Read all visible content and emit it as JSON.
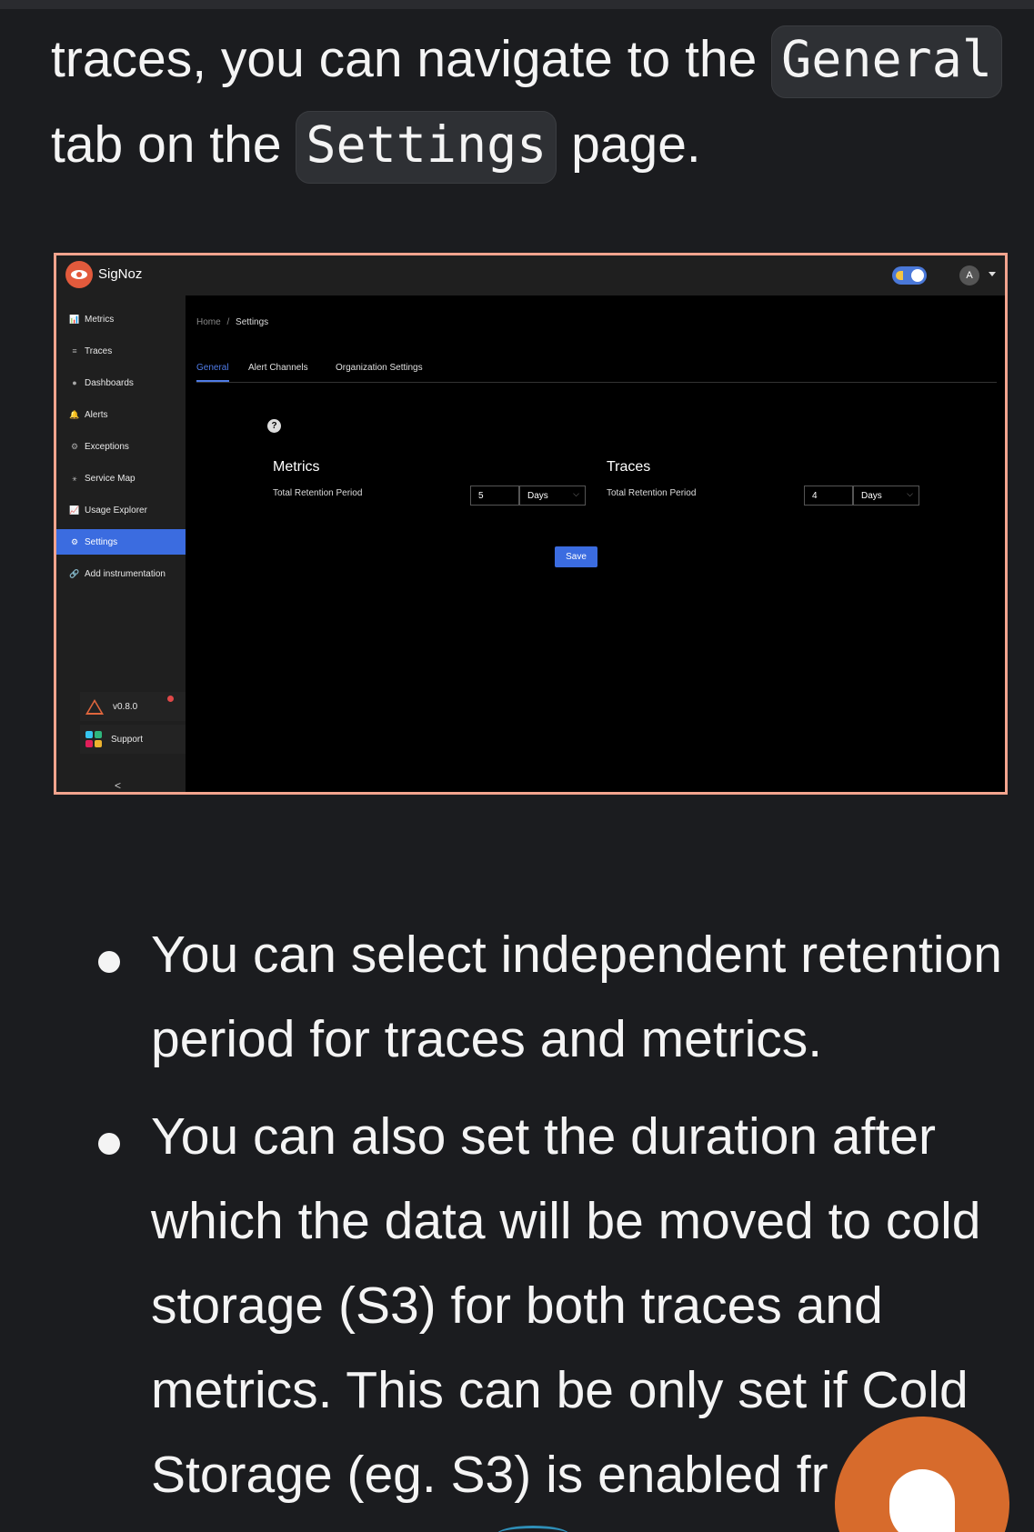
{
  "intro": {
    "part1": "traces, you can navigate to the ",
    "code1": "General",
    "part2": " tab on the ",
    "code2": "Settings",
    "part3": " page."
  },
  "screenshot": {
    "brand": "SigNoz",
    "avatar_initial": "A",
    "sidebar": {
      "items": [
        {
          "icon": "📊",
          "label": "Metrics"
        },
        {
          "icon": "≡",
          "label": "Traces"
        },
        {
          "icon": "●",
          "label": "Dashboards"
        },
        {
          "icon": "🔔",
          "label": "Alerts"
        },
        {
          "icon": "⚙",
          "label": "Exceptions"
        },
        {
          "icon": "⚹",
          "label": "Service Map"
        },
        {
          "icon": "📈",
          "label": "Usage Explorer"
        },
        {
          "icon": "⚙",
          "label": "Settings"
        },
        {
          "icon": "🔗",
          "label": "Add instrumentation"
        }
      ],
      "version": "v0.8.0",
      "support": "Support",
      "collapse": "<"
    },
    "breadcrumb": {
      "home": "Home",
      "sep": "/",
      "current": "Settings"
    },
    "tabs": [
      "General",
      "Alert Channels",
      "Organization Settings"
    ],
    "help": "?",
    "metrics": {
      "title": "Metrics",
      "label": "Total Retention Period",
      "value": "5",
      "unit": "Days"
    },
    "traces": {
      "title": "Traces",
      "label": "Total Retention Period",
      "value": "4",
      "unit": "Days"
    },
    "save_label": "Save",
    "chevron": "⌵"
  },
  "bullets": [
    {
      "lines": [
        "You can select independent retention",
        "period for traces and metrics."
      ]
    },
    {
      "lines": [
        "You can also set the duration after",
        "which the data will be moved to cold",
        "storage (S3) for both traces and",
        "metrics. This can be only set if Cold",
        "Storage (eg. S3) is enabled fr"
      ]
    }
  ],
  "colors": {
    "accent": "#3b6ce0",
    "brand": "#e25a3c",
    "fab": "#d76b2c",
    "frame": "#f2a48e"
  }
}
